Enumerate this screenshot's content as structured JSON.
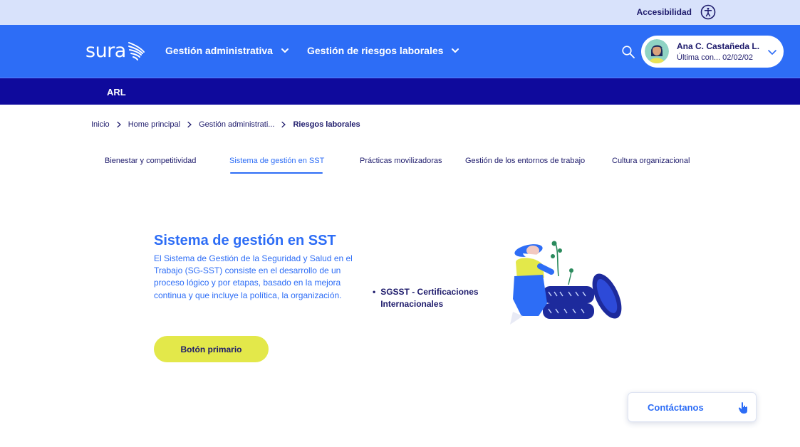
{
  "accessibility": {
    "label": "Accesibilidad",
    "icon": "accessibility-icon"
  },
  "header": {
    "logo_text": "sura",
    "nav": [
      {
        "label": "Gestión administrativa",
        "icon": "chevron-down-icon"
      },
      {
        "label": "Gestión de riesgos laborales",
        "icon": "chevron-down-icon"
      }
    ],
    "search_icon": "search-icon",
    "user": {
      "name": "Ana C. Castañeda L.",
      "last_connection": "Última con... 02/02/02"
    }
  },
  "subheader": {
    "label": "ARL"
  },
  "breadcrumb": [
    "Inicio",
    "Home principal",
    "Gestión administrati...",
    "Riesgos laborales"
  ],
  "tabs": [
    {
      "label": "Bienestar y competitividad",
      "active": false
    },
    {
      "label": "Sistema de gestión en SST",
      "active": true
    },
    {
      "label": "Prácticas movilizadoras",
      "active": false
    },
    {
      "label": "Gestión de los entornos de trabajo",
      "active": false
    },
    {
      "label": "Cultura organizacional",
      "active": false
    }
  ],
  "content": {
    "title": "Sistema de gestión en SST",
    "description": "El Sistema de Gestión de la Seguridad y Salud en el Trabajo (SG-SST) consiste en el desarrollo de un proceso lógico y por etapas, basado en la mejora continua y que incluye la política, la organización.",
    "primary_button": "Botón primario",
    "bullets": [
      "SGSST - Certificaciones Internacionales"
    ]
  },
  "contact": {
    "label": "Contáctanos",
    "icon": "hand-pointer-icon"
  },
  "colors": {
    "primary": "#2d6df6",
    "navy": "#1d1a6b",
    "subbar": "#0f0a9c",
    "topbar": "#d8e2fb",
    "accent": "#e3e84a"
  }
}
